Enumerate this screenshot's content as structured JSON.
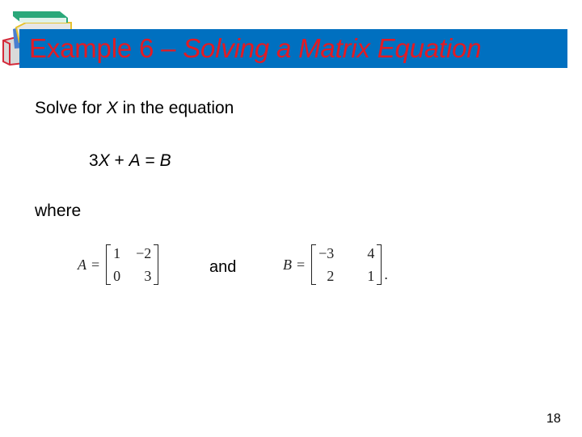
{
  "title": {
    "prefix": "Example 6 – ",
    "italic": "Solving a Matrix Equation"
  },
  "body": {
    "line1_pre": "Solve for ",
    "line1_var": "X",
    "line1_post": " in the equation",
    "equation": {
      "coef": "3",
      "var_x": "X",
      "plus": " + ",
      "var_a": "A",
      "equals": " = ",
      "var_b": "B"
    },
    "where": "where",
    "and": "and"
  },
  "matrices": {
    "A": {
      "name": "A",
      "equals": "=",
      "cells": [
        "1",
        "−2",
        "0",
        "3"
      ]
    },
    "B": {
      "name": "B",
      "equals": "=",
      "cells": [
        "−3",
        "4",
        "2",
        "1"
      ],
      "trailing": "."
    }
  },
  "page_number": "18",
  "icons": {
    "books": "stack-of-books-icon"
  },
  "colors": {
    "title_bar": "#0070c0",
    "title_text": "#e31b23"
  }
}
